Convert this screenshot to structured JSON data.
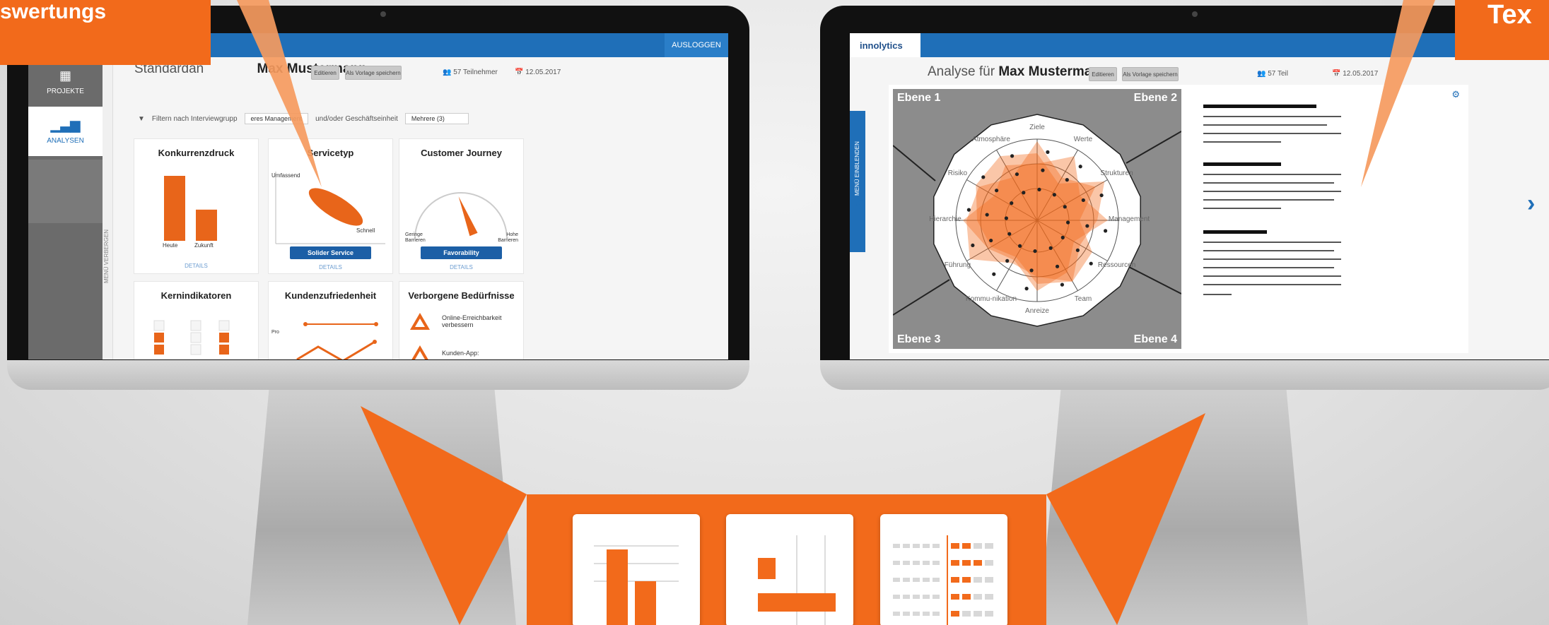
{
  "callouts": {
    "top_left": "swertungs",
    "top_right": "Tex"
  },
  "left_app": {
    "logout": "AUSLOGGEN",
    "nav": [
      {
        "label": "PROJEKTE",
        "icon": "grid-icon"
      },
      {
        "label": "ANALYSEN",
        "icon": "bar-chart-icon"
      }
    ],
    "side_handle_text": "MENÜ VERBERGEN",
    "title_prefix": "Standardan",
    "title_name": "Max Mustermann",
    "edit_button": "Editieren",
    "save_template_button": "Als Vorlage speichern",
    "participants": "57 Teilnehmer",
    "date": "12.05.2017",
    "filter_label": "Filtern nach Interviewgrupp",
    "filter_value": "eres Management",
    "and_or_label": "und/oder Geschäftseinheit",
    "unit_value": "Mehrere (3)",
    "details_label": "DETAILS",
    "cards": [
      {
        "title": "Konkurrenzdruck",
        "labels": [
          "Heute",
          "Zukunft"
        ]
      },
      {
        "title": "Servicetyp",
        "labels": [
          "Umfassend",
          "Schnell"
        ],
        "button": "Solider Service"
      },
      {
        "title": "Customer Journey",
        "labels": [
          "Geringe Barrieren",
          "Hohe Barrieren"
        ],
        "button": "Favorability"
      },
      {
        "title": "Kernindikatoren"
      },
      {
        "title": "Kundenzufriedenheit",
        "labels": [
          "Pro"
        ]
      },
      {
        "title": "Verborgene Bedürfnisse",
        "items": [
          "Online-Erreichbarkeit verbessern",
          "Kunden-App:"
        ]
      }
    ]
  },
  "left_charts": {
    "konkurrenzdruck": {
      "type": "bar",
      "categories": [
        "Heute",
        "Zukunft"
      ],
      "values": [
        100,
        48
      ],
      "color": "#e8651a"
    },
    "customer_journey": {
      "type": "gauge",
      "value": 0.38
    }
  },
  "right_app": {
    "logo": "innolytics",
    "title_prefix": "Analyse für",
    "title_name": "Max Mustermann",
    "edit_button": "Editieren",
    "save_template_button": "Als Vorlage speichern",
    "participants": "57 Teil",
    "date": "12.05.2017",
    "menu_tab_text": "MENÜ EINBLENDEN",
    "quadrants": [
      "Ebene 1",
      "Ebene 2",
      "Ebene 3",
      "Ebene 4"
    ],
    "radar_axes": [
      "Ziele",
      "Werte",
      "Strukturen",
      "Management",
      "Ressourcen",
      "Team",
      "Anreize",
      "Kommu-nikation",
      "Führung",
      "Hierarchie",
      "Risiko",
      "Atmosphäre"
    ]
  },
  "colors": {
    "orange": "#f26a1b",
    "blue": "#1f6fb8",
    "grey": "#8c8c8c"
  }
}
